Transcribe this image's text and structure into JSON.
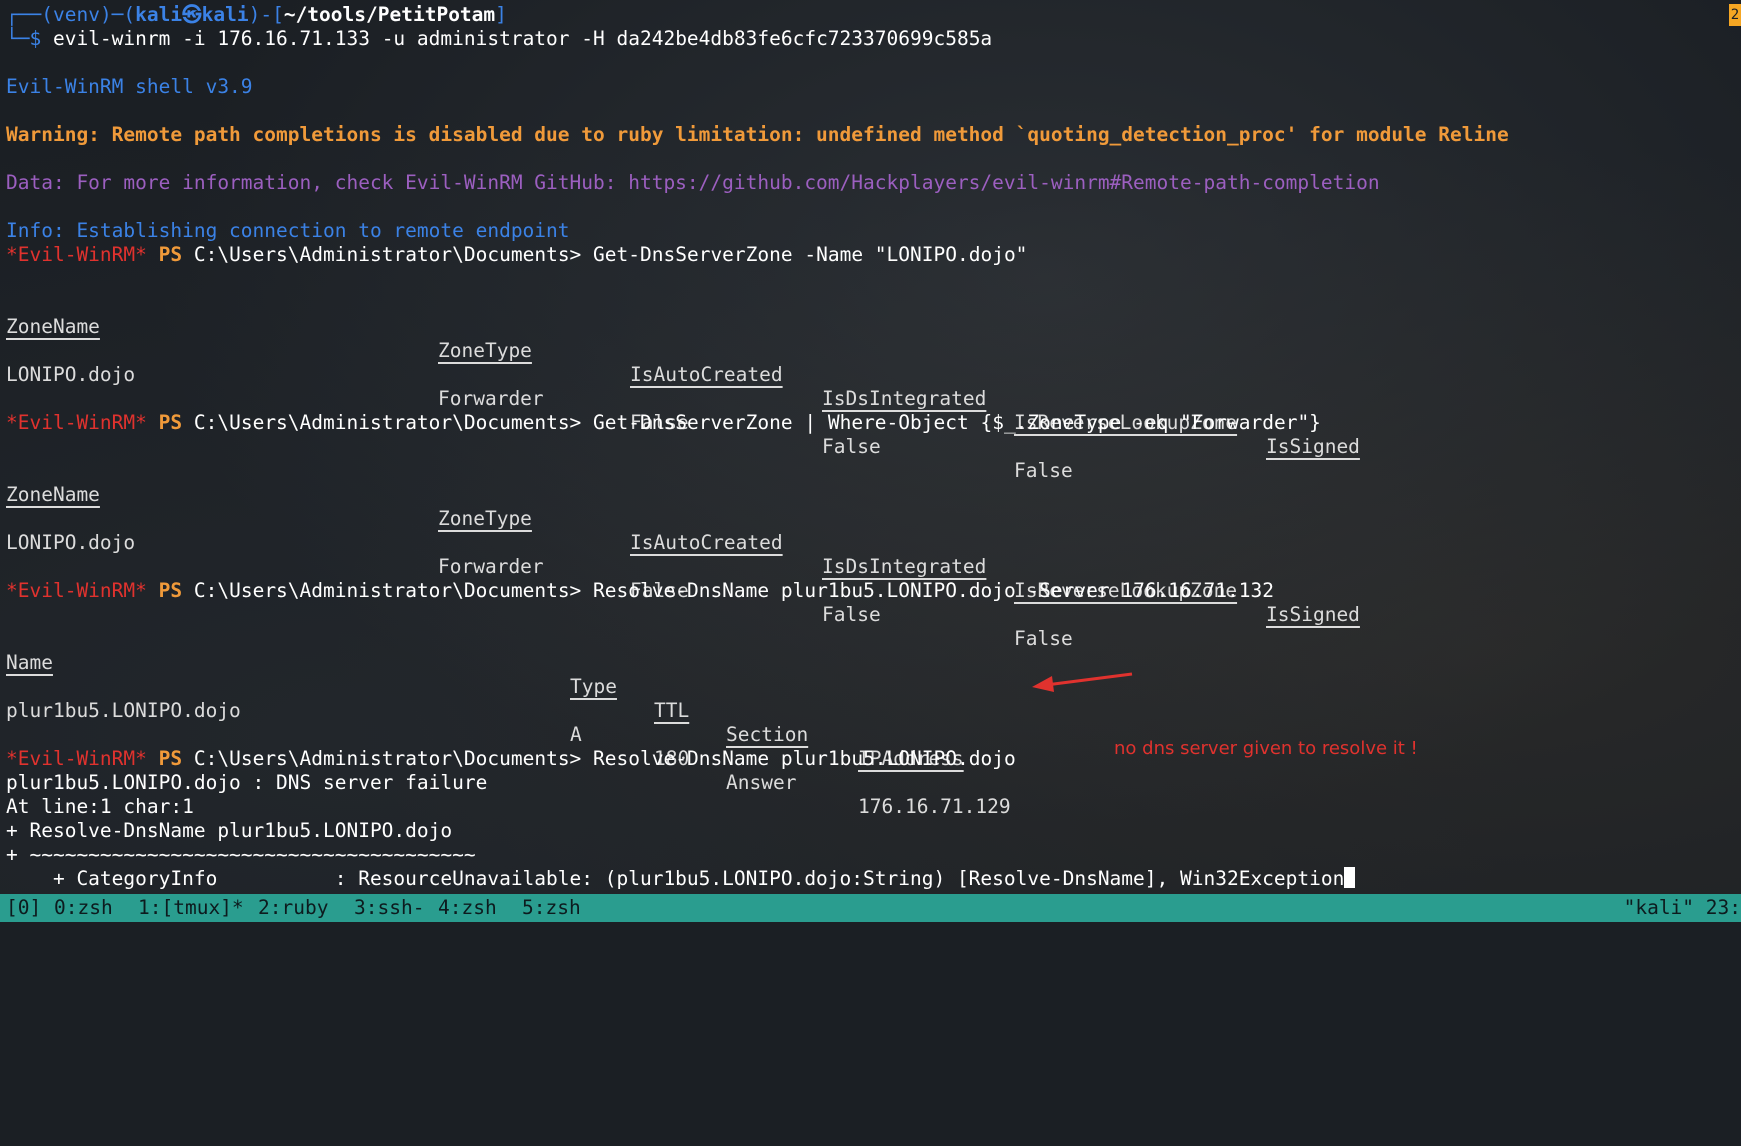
{
  "prompt": {
    "frame_top": "┌──(",
    "venv": "venv",
    "sep1": ")─(",
    "user_host": "kali㉿kali",
    "sep2": ")-[",
    "path": "~/tools/PetitPotam",
    "sep3": "]",
    "frame_bottom": "└─$ ",
    "command": "evil-winrm -i 176.16.71.133 -u administrator -H da242be4db83fe6cfc723370699c585a"
  },
  "shell_banner": "Evil-WinRM shell v3.9",
  "warning": "Warning: Remote path completions is disabled due to ruby limitation: undefined method `quoting_detection_proc' for module Reline",
  "data_line": "Data: For more information, check Evil-WinRM GitHub: https://github.com/Hackplayers/evil-winrm#Remote-path-completion",
  "info_line": "Info: Establishing connection to remote endpoint",
  "ps_prefix": "*Evil-WinRM*",
  "ps_label": "PS",
  "cwd": "C:\\Users\\Administrator\\Documents>",
  "commands": [
    "Get-DnsServerZone -Name \"LONIPO.dojo\"",
    "Get-DnsServerZone | Where-Object {$_.ZoneType -eq \"Forwarder\"}",
    "Resolve-DnsName plur1bu5.LONIPO.dojo -Server 176.16.71.132",
    "Resolve-DnsName plur1bu5.LONIPO.dojo"
  ],
  "zone_table": {
    "headers": [
      "ZoneName",
      "ZoneType",
      "IsAutoCreated",
      "IsDsIntegrated",
      "IsReverseLookupZone",
      "IsSigned"
    ],
    "row": [
      "LONIPO.dojo",
      "Forwarder",
      "False",
      "False",
      "False",
      ""
    ]
  },
  "dns_table": {
    "headers": [
      "Name",
      "Type",
      "TTL",
      "Section",
      "IPAddress"
    ],
    "row": [
      "plur1bu5.LONIPO.dojo",
      "A",
      "180",
      "Answer",
      "176.16.71.129"
    ]
  },
  "annotation": "no dns server given to resolve it !",
  "error_lines": [
    "plur1bu5.LONIPO.dojo : DNS server failure",
    "At line:1 char:1",
    "+ Resolve-DnsName plur1bu5.LONIPO.dojo",
    "+ ~~~~~~~~~~~~~~~~~~~~~~~~~~~~~~~~~~~~~~",
    "    + CategoryInfo          : ResourceUnavailable: (plur1bu5.LONIPO.dojo:String) [Resolve-DnsName], Win32Exception"
  ],
  "tmux": {
    "session": "[0]",
    "windows": [
      "0:zsh",
      "1:[tmux]*",
      "2:ruby",
      "3:ssh-",
      "4:zsh",
      "5:zsh"
    ],
    "host": "\"kali\" 23:"
  },
  "corner_badge": "2",
  "colors": {
    "background": "#1b1f24",
    "prompt_blue": "#3b82e6",
    "warning_orange": "#f09a3a",
    "data_purple": "#9c5fc0",
    "winrm_red": "#e0322e",
    "tmux_bar": "#2a9d8f"
  }
}
